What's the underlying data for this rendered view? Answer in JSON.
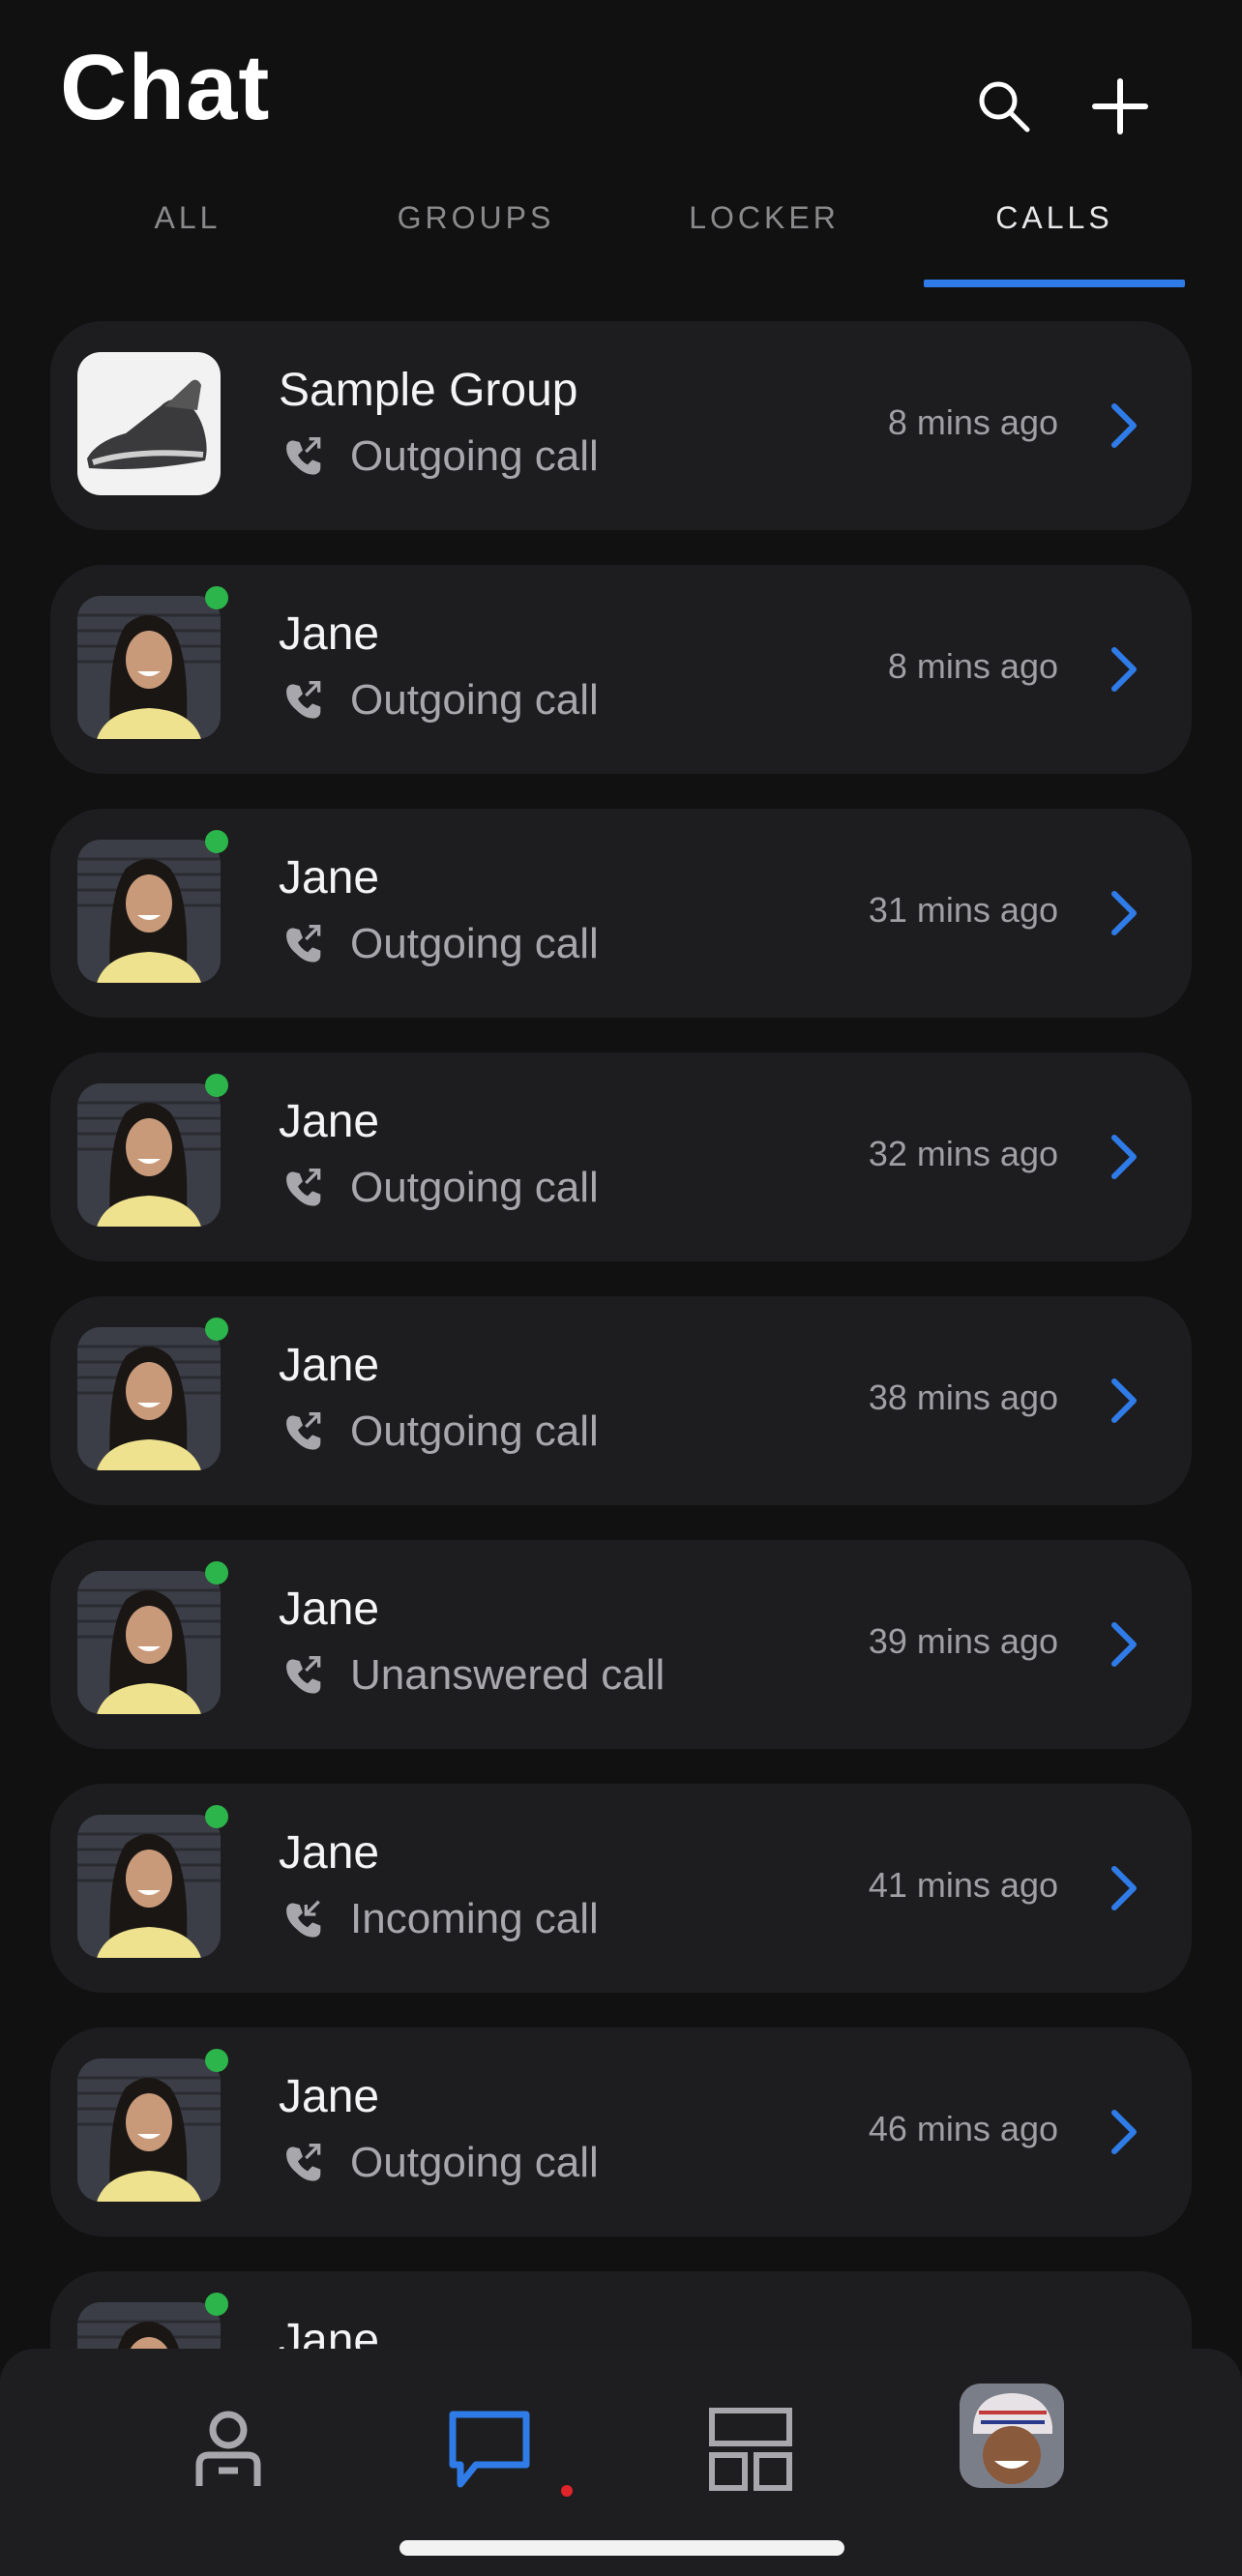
{
  "header": {
    "title": "Chat"
  },
  "tabs": [
    {
      "label": "ALL"
    },
    {
      "label": "GROUPS"
    },
    {
      "label": "LOCKER"
    },
    {
      "label": "CALLS",
      "active": true
    }
  ],
  "colors": {
    "accent": "#2f7be8",
    "online": "#2bb54a",
    "badge": "#e0242a",
    "card": "#1d1d1f",
    "background": "#111112"
  },
  "calls": [
    {
      "name": "Sample Group",
      "status": "Outgoing call",
      "direction": "outgoing",
      "time": "8 mins ago",
      "avatar": "shoe-image",
      "online": false
    },
    {
      "name": "Jane",
      "status": "Outgoing call",
      "direction": "outgoing",
      "time": "8 mins ago",
      "avatar": "jane-photo",
      "online": true
    },
    {
      "name": "Jane",
      "status": "Outgoing call",
      "direction": "outgoing",
      "time": "31 mins ago",
      "avatar": "jane-photo",
      "online": true
    },
    {
      "name": "Jane",
      "status": "Outgoing call",
      "direction": "outgoing",
      "time": "32 mins ago",
      "avatar": "jane-photo",
      "online": true
    },
    {
      "name": "Jane",
      "status": "Outgoing call",
      "direction": "outgoing",
      "time": "38 mins ago",
      "avatar": "jane-photo",
      "online": true
    },
    {
      "name": "Jane",
      "status": "Unanswered call",
      "direction": "outgoing",
      "time": "39 mins ago",
      "avatar": "jane-photo",
      "online": true
    },
    {
      "name": "Jane",
      "status": "Incoming call",
      "direction": "incoming",
      "time": "41 mins ago",
      "avatar": "jane-photo",
      "online": true
    },
    {
      "name": "Jane",
      "status": "Outgoing call",
      "direction": "outgoing",
      "time": "46 mins ago",
      "avatar": "jane-photo",
      "online": true
    },
    {
      "name": "Jane",
      "status": "",
      "direction": "outgoing",
      "time": "",
      "avatar": "jane-photo",
      "online": true
    }
  ],
  "bottom_nav": [
    {
      "icon": "person-icon",
      "active": false
    },
    {
      "icon": "chat-bubble-icon",
      "active": true,
      "badge": true
    },
    {
      "icon": "dashboard-icon",
      "active": false
    },
    {
      "icon": "profile-avatar",
      "active": false
    }
  ]
}
